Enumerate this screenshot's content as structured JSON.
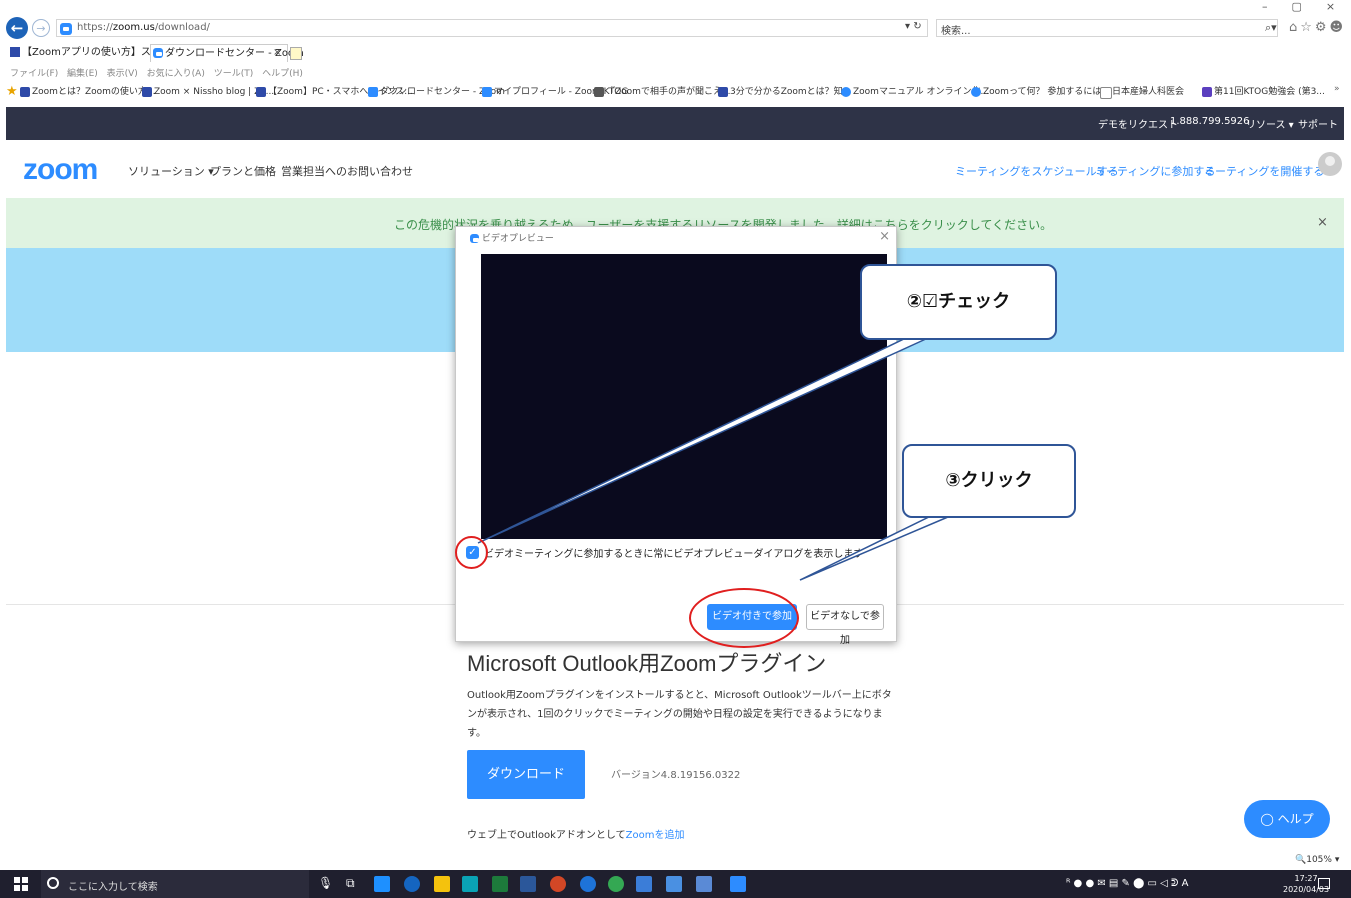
{
  "browser": {
    "url_prefix": "https://",
    "url_domain": "zoom.us",
    "url_path": "/download/",
    "search_placeholder": "検索...",
    "tabs": [
      {
        "label": "【Zoomアプリの使い方】スマホを使..."
      },
      {
        "label": "ダウンロードセンター - Zoom"
      }
    ],
    "tab_close": "×",
    "menu": "ファイル(F) 編集(E) 表示(V) お気に入り(A) ツール(T) ヘルプ(H)",
    "favorites": [
      "Zoomとは？Zoomの使い方...",
      "Zoom × Nissho blog | Zo...",
      "【Zoom】PC・スマホへのインス...",
      "ダウンロードセンター - Zoom",
      "マイプロフィール - Zoom KTOG",
      "『Zoomで相手の声が聞こえ...",
      "3分で分かるZoomとは？知...",
      "Zoomマニュアル オンライン化...",
      "Zoomって何？ 参加するには...",
      "日本産婦人科医会",
      "第11回KTOG勉強会 (第3..."
    ],
    "zoom_level": "105%"
  },
  "zoom_site": {
    "topbar": {
      "demo": "デモをリクエスト",
      "phone": "1.888.799.5926",
      "resources": "リソース ▾",
      "support": "サポート"
    },
    "logo": "zoom",
    "nav": {
      "solutions": "ソリューション ▾",
      "plans": "プランと価格",
      "sales": "営業担当へのお問い合わせ"
    },
    "nav_right": {
      "schedule": "ミーティングをスケジュールする",
      "join": "ミーティングに参加する",
      "host": "ミーティングを開催する ▾"
    },
    "banner": "この危機的状況を乗り越えるため、ユーザーを支援するリソースを開発しました。詳細はこちらをクリックしてください。",
    "banner_close": "×",
    "plugin_title": "Microsoft Outlook用Zoomプラグイン",
    "plugin_desc": "Outlook用Zoomプラグインをインストールするとと、Microsoft Outlookツールバー上にボタンが表示され、1回のクリックでミーティングの開始や日程の設定を実行できるようになります。",
    "download": "ダウンロード",
    "version": "バージョン4.8.19156.0322",
    "addon_prefix": "ウェブ上でOutlookアドオンとして",
    "addon_link": "Zoomを追加",
    "help": "ヘルプ"
  },
  "dialog": {
    "title": "ビデオプレビュー",
    "close": "×",
    "checkbox_label": "ビデオミーティングに参加するときに常にビデオプレビューダイアログを表示します",
    "checkbox_checked": true,
    "join_with_video": "ビデオ付きで参加",
    "join_without_video": "ビデオなしで参加"
  },
  "annotations": {
    "step2": "②☑チェック",
    "step3": "③クリック",
    "ring_color": "#e01f1f",
    "callout_border": "#2f5597"
  },
  "taskbar": {
    "search": "ここに入力して検索",
    "time": "17:27",
    "date": "2020/04/03"
  }
}
